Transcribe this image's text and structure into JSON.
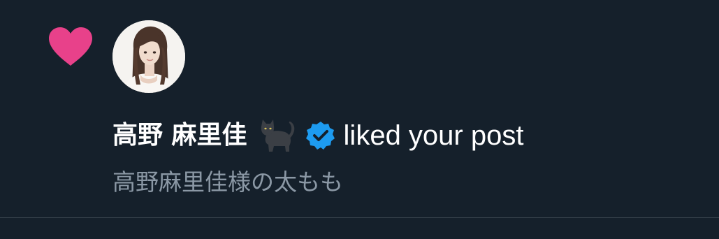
{
  "notification": {
    "type_icon": "heart-icon",
    "avatar_icon": "profile-photo",
    "user_name": "高野 麻里佳",
    "name_emoji": "black-cat-icon",
    "verified_icon": "verified-badge-icon",
    "action_text": "liked your post",
    "post_preview": "高野麻里佳様の太もも"
  },
  "colors": {
    "background": "#15202b",
    "heart": "#e8418a",
    "verified": "#1d9bf0",
    "primary_text": "#ffffff",
    "secondary_text": "#8b98a5",
    "divider": "#38444d"
  }
}
